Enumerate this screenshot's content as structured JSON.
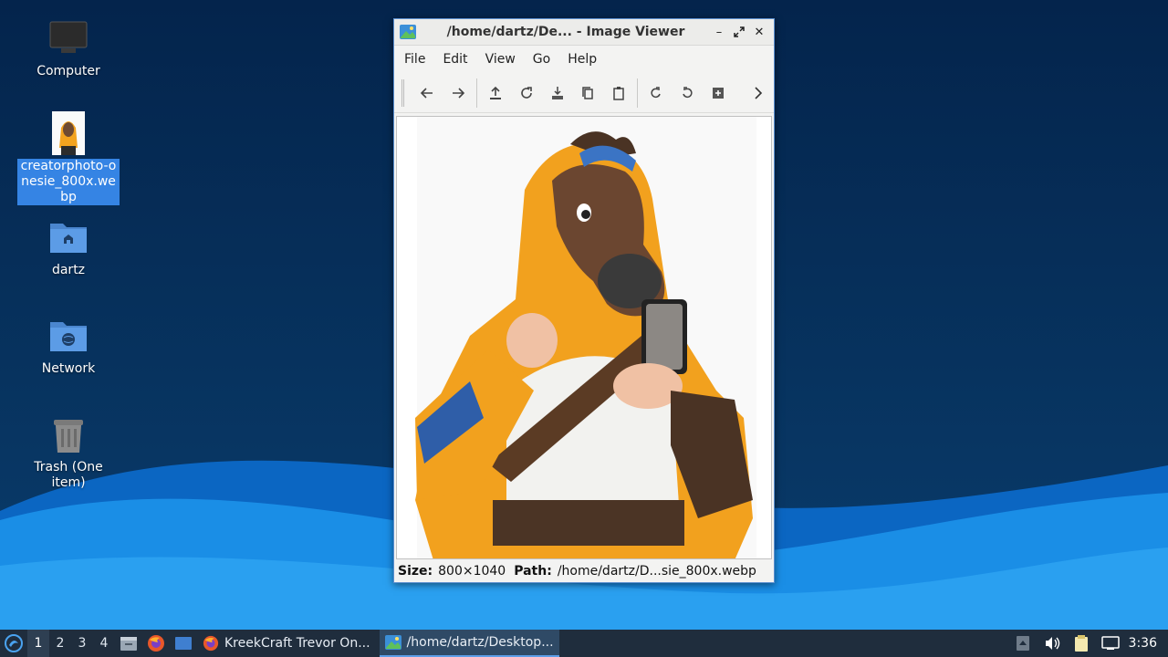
{
  "desktop": {
    "icons": [
      {
        "label": "Computer",
        "icon": "computer-icon"
      },
      {
        "label": "creatorphoto-onesie_800x.webp",
        "icon": "image-file-icon"
      },
      {
        "label": "dartz",
        "icon": "home-folder-icon"
      },
      {
        "label": "Network",
        "icon": "network-folder-icon"
      },
      {
        "label": "Trash (One item)",
        "icon": "trash-icon"
      }
    ]
  },
  "window": {
    "title": "/home/dartz/De...  - Image Viewer",
    "menu": [
      "File",
      "Edit",
      "View",
      "Go",
      "Help"
    ],
    "status": {
      "size_label": "Size:",
      "size_value": "800×1040",
      "path_label": "Path:",
      "path_value": "/home/dartz/D...sie_800x.webp"
    }
  },
  "taskbar": {
    "workspaces": [
      "1",
      "2",
      "3",
      "4"
    ],
    "tasks": [
      {
        "label": "KreekCraft Trevor On...",
        "icon": "firefox-icon"
      },
      {
        "label": "/home/dartz/Desktop...",
        "icon": "image-viewer-icon"
      }
    ],
    "clock": "3:36"
  },
  "colors": {
    "selection": "#3584e4",
    "taskbar": "#1f2d3d",
    "desktop_wave": "#1a8ee6"
  }
}
